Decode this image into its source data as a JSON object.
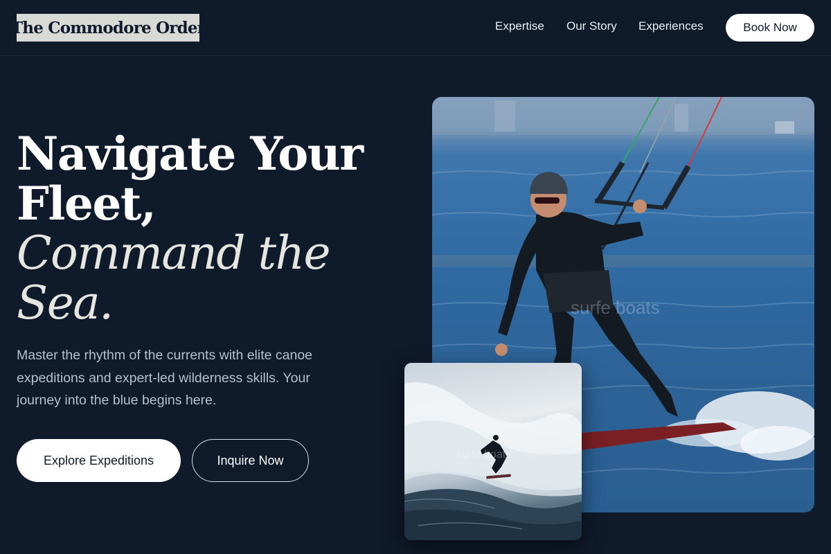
{
  "header": {
    "logo_text": "The Commodore Order",
    "nav": [
      {
        "label": "Expertise"
      },
      {
        "label": "Our Story"
      },
      {
        "label": "Experiences"
      }
    ],
    "book_label": "Book Now"
  },
  "hero": {
    "headline_line1": "Navigate Your",
    "headline_line2": "Fleet,",
    "headline_italic_line1": "Command the",
    "headline_italic_line2": "Sea.",
    "subtext": "Master the rhythm of the currents with elite canoe expeditions and expert-led wilderness skills. Your journey into the blue begins here.",
    "primary_button": "Explore Expeditions",
    "secondary_button": "Inquire Now"
  },
  "images": {
    "main_watermark": "surfe boats",
    "second_watermark": "surfe boats"
  },
  "colors": {
    "background": "#0f1a2a",
    "accent_white": "#ffffff",
    "logo_bg": "#d9d9d6"
  }
}
